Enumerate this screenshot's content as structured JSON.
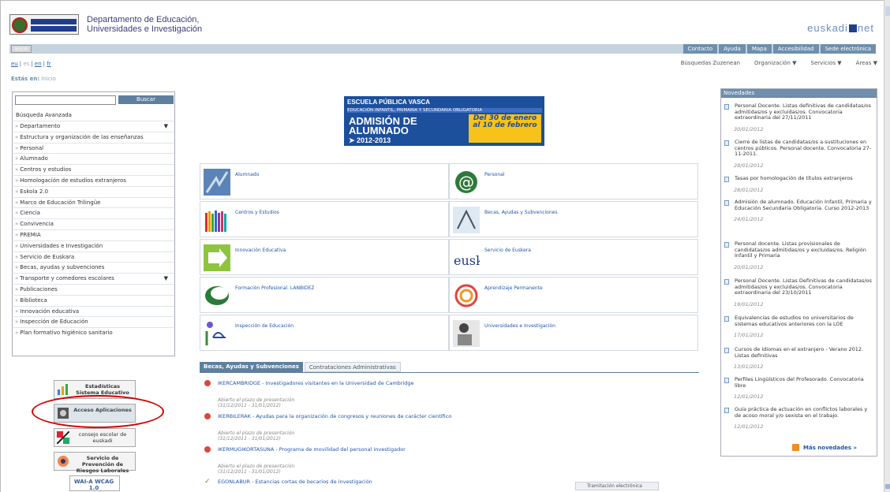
{
  "header": {
    "dept_line1": "Departamento de Educación,",
    "dept_line2": "Universidades e Investigación",
    "brand_left": "euskadi",
    "brand_right": "net"
  },
  "topbar": {
    "inicio": "Inicio",
    "links": [
      "Contacto",
      "Ayuda",
      "Mapa",
      "Accesibilidad",
      "Sede electrónica"
    ]
  },
  "languages": [
    "eu",
    "es",
    "en",
    "fr"
  ],
  "second_nav": {
    "items": [
      "Búsquedas Zuzenean",
      "Organización",
      "Servicios",
      "Áreas"
    ]
  },
  "breadcrumb": {
    "label": "Estás en:",
    "current": "Inicio"
  },
  "search": {
    "button": "Buscar",
    "advanced": "Búsqueda Avanzada"
  },
  "menu": [
    "Departamento",
    "Estructura y organización de las enseñanzas",
    "Personal",
    "Alumnado",
    "Centros y estudios",
    "Homologación de estudios extranjeros",
    "Eskola 2.0",
    "Marco de Educación Trilingüe",
    "Ciencia",
    "Convivencia",
    "PREMIA",
    "Universidades e Investigación",
    "Servicio de Euskara",
    "Becas, ayudas y subvenciones",
    "Transporte y comedores escolares",
    "Publicaciones",
    "Biblioteca",
    "Innovación educativa",
    "Inspección de Educación",
    "Plan formativo higiénico sanitario"
  ],
  "side_buttons": {
    "stats": "Estadísticas Sistema Educativo",
    "apps": "Acceso Aplicaciones",
    "consejo": "consejo escolar de euskadi",
    "prevencion": "Servicio de Prevención de Riesgos Laborales",
    "wai": "WAI-A WCAG 1.0"
  },
  "banner": {
    "line1": "ESCUELA PÚBLICA VASCA",
    "line2": "EDUCACIÓN INFANTIL, PRIMARIA Y SECUNDARIA OBLIGATORIA",
    "line3": "ADMISIÓN DE ALUMNADO",
    "line4": "➤ 2012-2013",
    "date": "Del 30 de enero al 10 de febrero"
  },
  "grid": [
    "Alumnado",
    "Personal",
    "Centros y Estudios",
    "Becas, Ayudas y Subvenciones",
    "Innovación Educativa",
    "Servicio de Euskera",
    "Formación Profesional. LANBIDEZ",
    "Aprendizaje Permanente",
    "Inspección de Educación",
    "Universidades e Investigación"
  ],
  "euskera_logo": "eusk",
  "tabs": [
    "Becas, Ayudas y Subvenciones",
    "Contrataciones Administrativas"
  ],
  "tab_items": [
    {
      "title": "IKERCAMBRIDGE - Investigadores visitantes en la Universidad de Cambridge",
      "note1": "Abierto el plazo de presentación",
      "note2": "(31/12/2011 - 31/01/2012)"
    },
    {
      "title": "IKERBILERAK - Ayudas para la organización de congresos y reuniones de carácter científico",
      "note1": "Abierto el plazo de presentación",
      "note2": "(31/12/2011 - 31/01/2012)"
    },
    {
      "title": "IKERMUGIKORTASUNA - Programa de movilidad del personal investigador",
      "note1": "Abierto el plazo de presentación",
      "note2": "(31/12/2011 - 31/01/2012)"
    },
    {
      "title": "EGONLABUR - Estancias cortas de becarios de investigación",
      "note1": "",
      "note2": ""
    }
  ],
  "tramitacion": "Tramitación electrónica",
  "news": {
    "heading": "Novedades",
    "items": [
      {
        "text": "Personal Docente. Listas definitivas de candidatas/os admitidas/os y excluidas/os. Convocatoria extraordinaria del 27/11/2011",
        "date": "30/01/2012"
      },
      {
        "text": "Cierre de listas de candidatas/os a sustituciones en centros públicos. Personal docente. Convocatoria 27-11-2011.",
        "date": "28/01/2012"
      },
      {
        "text": "Tasas por homologación de títulos extranjeros",
        "date": "28/01/2012"
      },
      {
        "text": "Admisión de alumnado. Educación Infantil, Primaria y Educación Secundaria Obligatoria. Curso 2012-2013",
        "date": "24/01/2012"
      },
      {
        "text": "Personal docente. Listas provisionales de candidatas/os admitidas/os y excluidas/os. Religión Infantil y Primaria",
        "date": "20/01/2012"
      },
      {
        "text": "Personal Docente. Listas Definitivas de candidatas/os admitidas/os y excluidas/os. Convocatoria extraordinaria del 23/10/2011",
        "date": "19/01/2012"
      },
      {
        "text": "Equivalencias de estudios no universitarios de sistemas educativos anteriores con la LOE",
        "date": "17/01/2012"
      },
      {
        "text": "Cursos de idiomas en el extranjero - Verano 2012. Listas definitivas",
        "date": "13/01/2012"
      },
      {
        "text": "Perfiles Lingüísticos del Profesorado. Convocatoria libre",
        "date": "12/01/2012"
      },
      {
        "text": "Guía práctica de actuación en conflictos laborales y de acoso moral y/o sexista en el trabajo.",
        "date": "12/01/2012"
      }
    ],
    "more": "Más novedades",
    "more_arrow": "»"
  }
}
